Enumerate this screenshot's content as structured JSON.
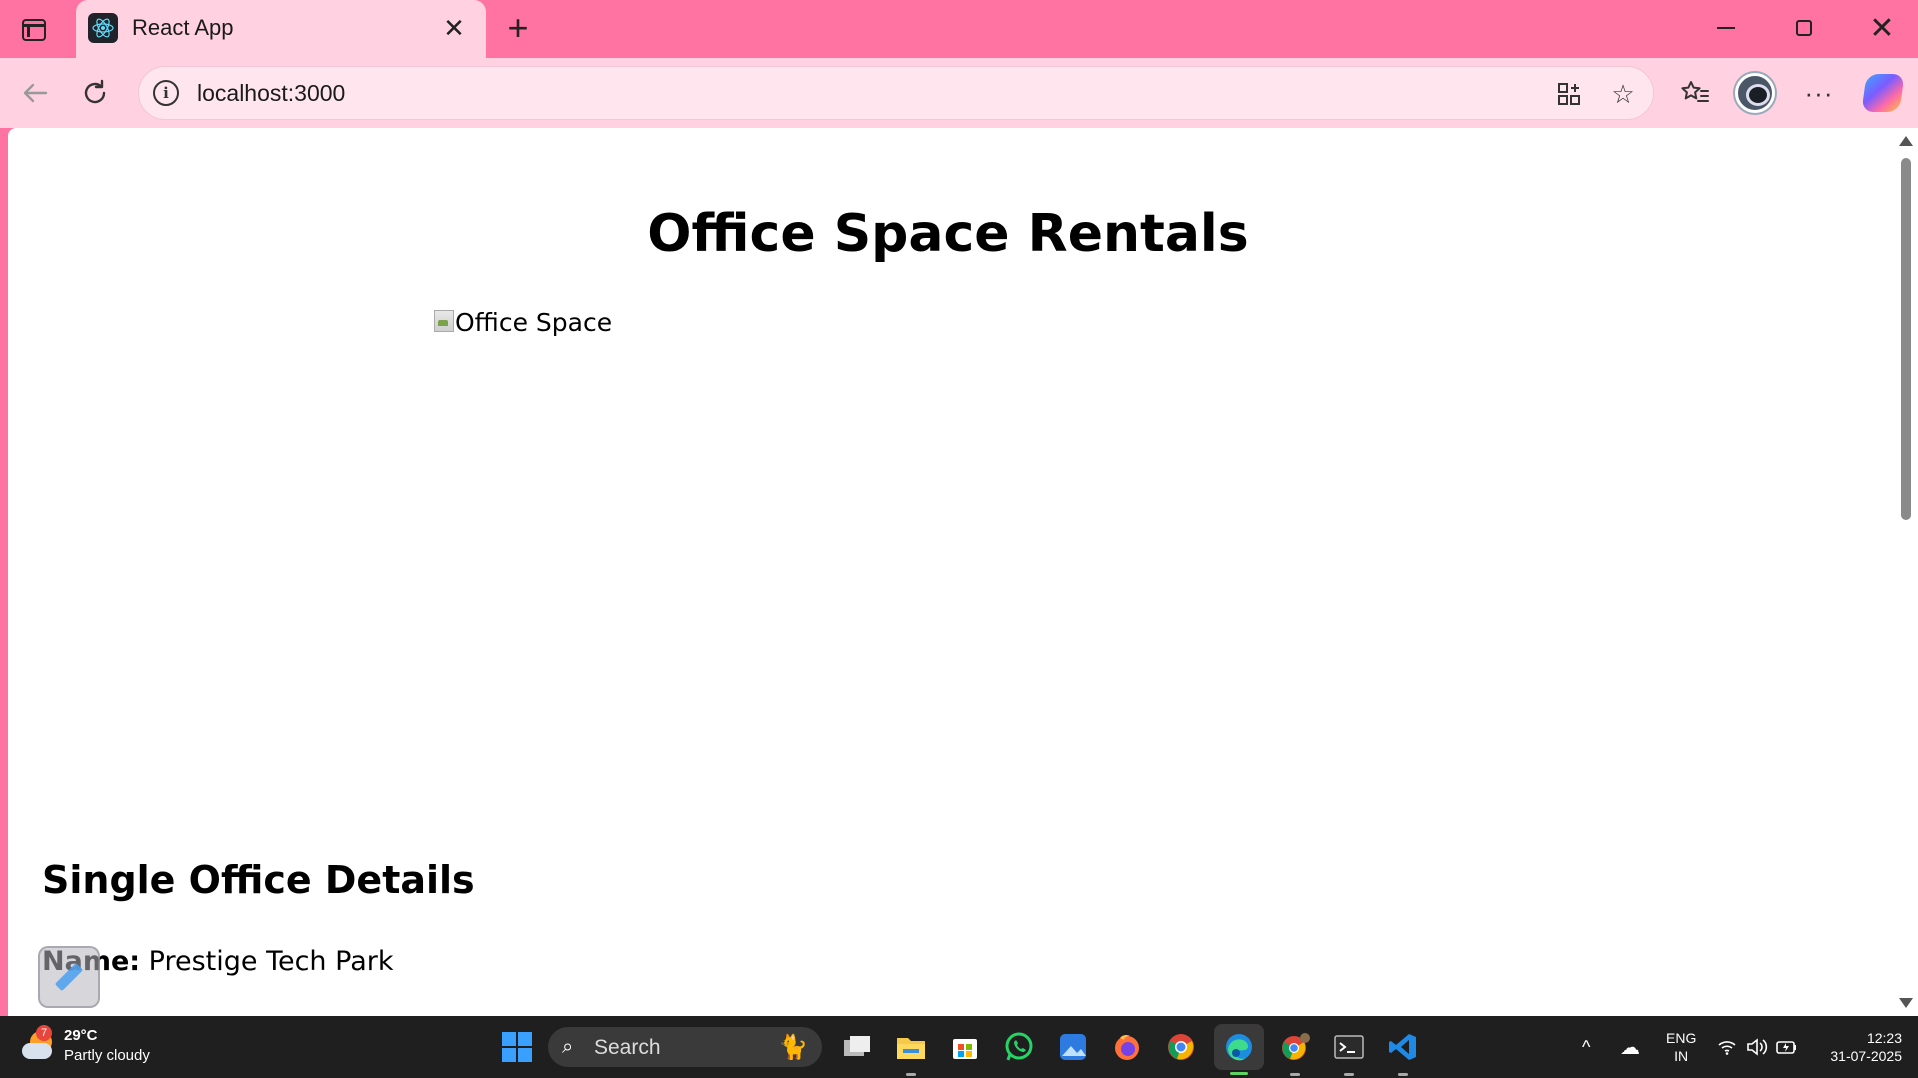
{
  "browser": {
    "tab_title": "React App",
    "url": "localhost:3000"
  },
  "page": {
    "heading": "Office Space Rentals",
    "image_alt": "Office Space",
    "section_title": "Single Office Details",
    "name_label": "Name:",
    "name_value": "Prestige Tech Park"
  },
  "taskbar": {
    "weather_temp": "29°C",
    "weather_desc": "Partly cloudy",
    "weather_badge": "7",
    "search_placeholder": "Search",
    "lang_top": "ENG",
    "lang_bottom": "IN",
    "time": "12:23",
    "date": "31-07-2025",
    "apps": [
      "task-view",
      "file-explorer",
      "microsoft-store",
      "whatsapp",
      "photos",
      "firefox",
      "chrome",
      "edge",
      "chrome-profile",
      "terminal",
      "vscode"
    ]
  },
  "colors": {
    "tab_strip": "#ff73a3",
    "toolbar": "#ffd1e1",
    "taskbar": "#1f1f1f"
  }
}
